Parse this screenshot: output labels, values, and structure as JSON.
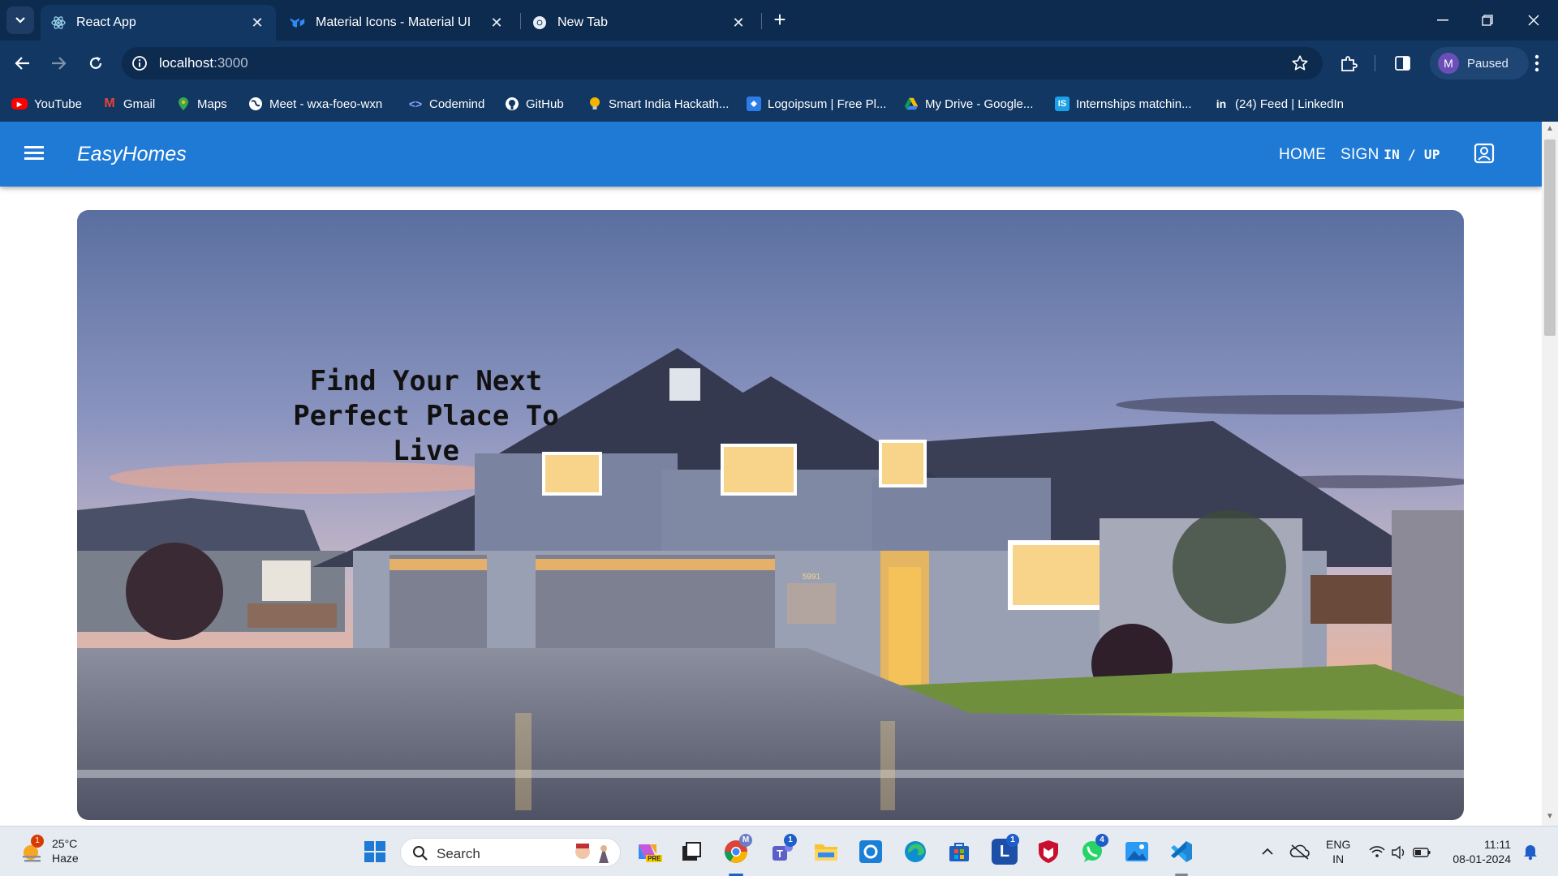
{
  "browser": {
    "tabs": [
      {
        "title": "React App",
        "active": true,
        "icon": "react-icon"
      },
      {
        "title": "Material Icons - Material UI",
        "active": false,
        "icon": "mui-icon"
      },
      {
        "title": "New Tab",
        "active": false,
        "icon": "chrome-icon"
      }
    ],
    "url_host": "localhost",
    "url_port": ":3000",
    "profile_initial": "M",
    "profile_status": "Paused"
  },
  "bookmarks": [
    {
      "label": "YouTube",
      "icon": "youtube-icon",
      "color": "#ff0000"
    },
    {
      "label": "Gmail",
      "icon": "gmail-icon",
      "color": "#ea4335"
    },
    {
      "label": "Maps",
      "icon": "maps-icon",
      "color": "#34a853"
    },
    {
      "label": "Meet - wxa-foeo-wxn",
      "icon": "globe-icon",
      "color": "#ffffff"
    },
    {
      "label": "Codemind",
      "icon": "codemind-icon",
      "color": "#6b8cff"
    },
    {
      "label": "GitHub",
      "icon": "github-icon",
      "color": "#ffffff"
    },
    {
      "label": "Smart India Hackath...",
      "icon": "sih-icon",
      "color": "#f4b400"
    },
    {
      "label": "Logoipsum | Free Pl...",
      "icon": "logoipsum-icon",
      "color": "#2b7de9"
    },
    {
      "label": "My Drive - Google...",
      "icon": "drive-icon",
      "color": "#0f9d58"
    },
    {
      "label": "Internships matchin...",
      "icon": "internshala-icon",
      "color": "#1aa1e8"
    },
    {
      "label": "(24) Feed | LinkedIn",
      "icon": "linkedin-icon",
      "color": "#ffffff"
    }
  ],
  "app": {
    "brand": "EasyHomes",
    "nav_home": "HOME",
    "nav_sign": "SIGN",
    "nav_inup": "IN / UP",
    "hero_title": "Find Your Next Perfect Place To Live",
    "accent_color": "#1f7ad6",
    "house_number": "5991"
  },
  "taskbar": {
    "temperature": "25°C",
    "weather": "Haze",
    "weather_badge": "1",
    "search_placeholder": "Search",
    "teams_badge": "1",
    "lens_badge": "1",
    "whatsapp_badge": "4",
    "chrome_badge": "M",
    "language": "ENG",
    "region": "IN",
    "time": "11:11",
    "date": "08-01-2024",
    "pre_label": "PRE"
  }
}
